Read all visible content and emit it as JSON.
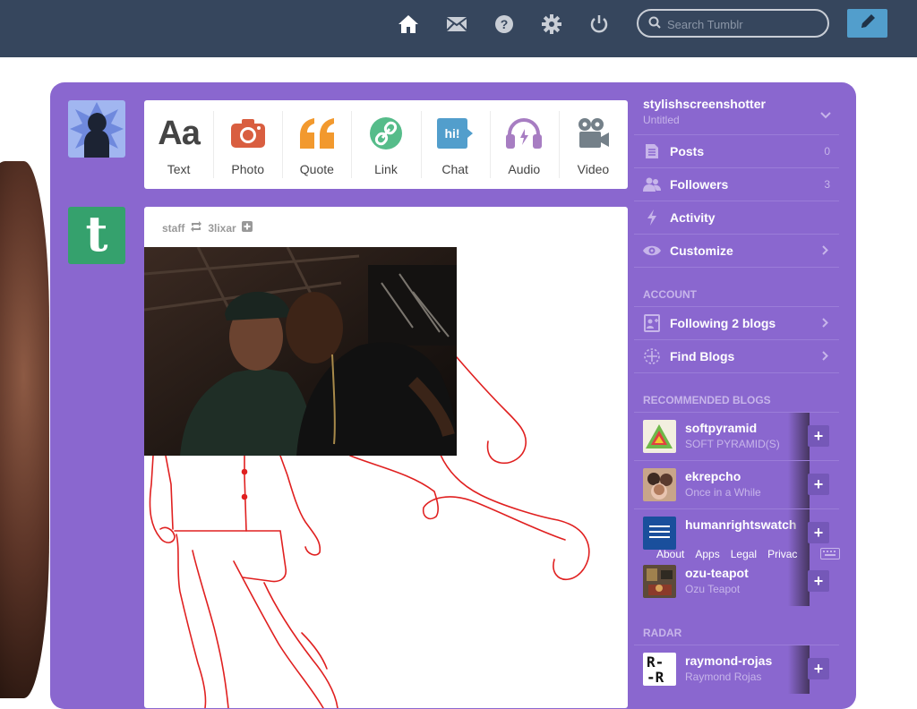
{
  "nav": {
    "search_placeholder": "Search Tumblr",
    "icons": [
      "home-icon",
      "inbox-icon",
      "help-icon",
      "settings-icon",
      "logout-icon",
      "compose-icon"
    ]
  },
  "post_types": [
    {
      "label": "Text",
      "icon": "text-icon",
      "color": "#444444"
    },
    {
      "label": "Photo",
      "icon": "camera-icon",
      "color": "#d95e40"
    },
    {
      "label": "Quote",
      "icon": "quote-icon",
      "color": "#f2992e"
    },
    {
      "label": "Link",
      "icon": "link-icon",
      "color": "#56bc8a"
    },
    {
      "label": "Chat",
      "icon": "chat-icon",
      "color": "#529ecc"
    },
    {
      "label": "Audio",
      "icon": "headphones-icon",
      "color": "#a77dc2"
    },
    {
      "label": "Video",
      "icon": "video-camera-icon",
      "color": "#748089"
    }
  ],
  "post": {
    "author": "staff",
    "reblogged_from": "3lixar"
  },
  "blog": {
    "name": "stylishscreenshotter",
    "subtitle": "Untitled",
    "items": [
      {
        "label": "Posts",
        "count": "0"
      },
      {
        "label": "Followers",
        "count": "3"
      },
      {
        "label": "Activity",
        "count": ""
      },
      {
        "label": "Customize",
        "count": ""
      }
    ]
  },
  "account": {
    "heading": "ACCOUNT",
    "items": [
      {
        "label": "Following 2 blogs"
      },
      {
        "label": "Find Blogs"
      }
    ]
  },
  "recommended": {
    "heading": "RECOMMENDED BLOGS",
    "blogs": [
      {
        "name": "softpyramid",
        "subtitle": "SOFT PYRAMID(S)"
      },
      {
        "name": "ekrepcho",
        "subtitle": "Once in a While"
      },
      {
        "name": "humanrightswatch",
        "subtitle": ""
      },
      {
        "name": "ozu-teapot",
        "subtitle": "Ozu Teapot"
      }
    ]
  },
  "footer": {
    "links": [
      "About",
      "Apps",
      "Legal",
      "Privac"
    ]
  },
  "radar": {
    "heading": "RADAR",
    "blog": {
      "name": "raymond-rojas",
      "subtitle": "Raymond Rojas",
      "avatar_text": "R-\n-R"
    }
  },
  "colors": {
    "nav_bg": "#36465d",
    "dashboard_bg": "#8a67cf",
    "compose_blue": "#529ecc",
    "tumblr_green": "#35a16d"
  }
}
